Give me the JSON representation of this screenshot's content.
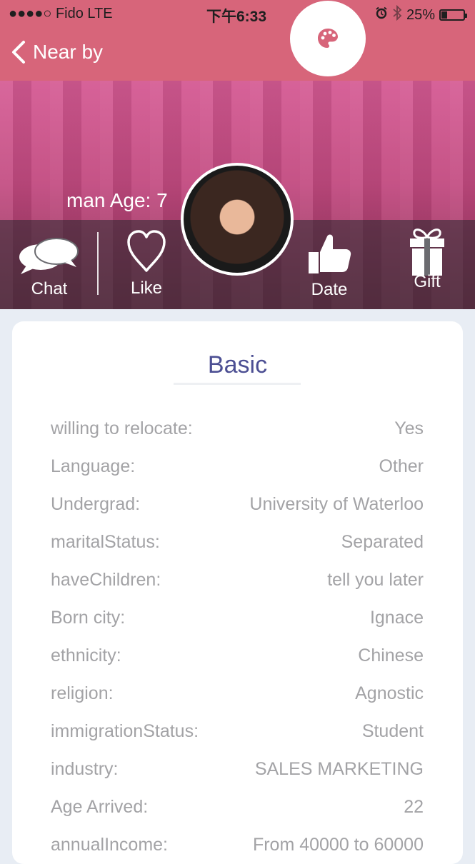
{
  "status_bar": {
    "carrier": "●●●●○ Fido  LTE",
    "time": "下午6:33",
    "battery": "25%",
    "battery_level": 0.25
  },
  "nav": {
    "back_label": "Near by",
    "accent_color": "#d7657a"
  },
  "profile": {
    "meta": "man Age: 7"
  },
  "actions": [
    {
      "label": "Chat"
    },
    {
      "label": "Like"
    },
    {
      "label": "Date"
    },
    {
      "label": "Gift"
    }
  ],
  "basic": {
    "title": "Basic",
    "rows": [
      {
        "key": "willing to relocate:",
        "value": "Yes"
      },
      {
        "key": "Language:",
        "value": "Other"
      },
      {
        "key": "Undergrad:",
        "value": "University of Waterloo"
      },
      {
        "key": "maritalStatus:",
        "value": "Separated"
      },
      {
        "key": "haveChildren:",
        "value": "tell you later"
      },
      {
        "key": "Born city:",
        "value": "Ignace"
      },
      {
        "key": "ethnicity:",
        "value": "Chinese"
      },
      {
        "key": "religion:",
        "value": "Agnostic"
      },
      {
        "key": "immigrationStatus:",
        "value": "Student"
      },
      {
        "key": "industry:",
        "value": "SALES MARKETING"
      },
      {
        "key": "Age Arrived:",
        "value": "22"
      },
      {
        "key": "annualIncome:",
        "value": "From 40000 to 60000"
      }
    ]
  }
}
